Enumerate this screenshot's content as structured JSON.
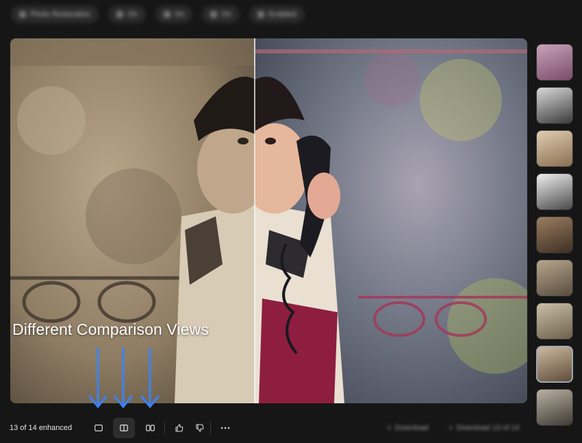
{
  "toolbar": {
    "items": [
      "Photo Restoration",
      "On",
      "On",
      "On",
      "Enabled"
    ]
  },
  "viewer": {
    "overlay_caption": "Different Comparison Views"
  },
  "thumbnails": {
    "count": 9,
    "selected_index": 7
  },
  "footer": {
    "status": "13 of 14 enhanced",
    "download_label": "Download",
    "download_all_label": "Download 13 of 14"
  },
  "colors": {
    "background": "#161616",
    "arrow": "#3b82f6",
    "active_button": "#2d2d2d"
  },
  "icons": [
    "single-view-icon",
    "split-view-icon",
    "side-by-side-view-icon",
    "thumbs-up-icon",
    "thumbs-down-icon",
    "more-icon",
    "download-icon"
  ]
}
